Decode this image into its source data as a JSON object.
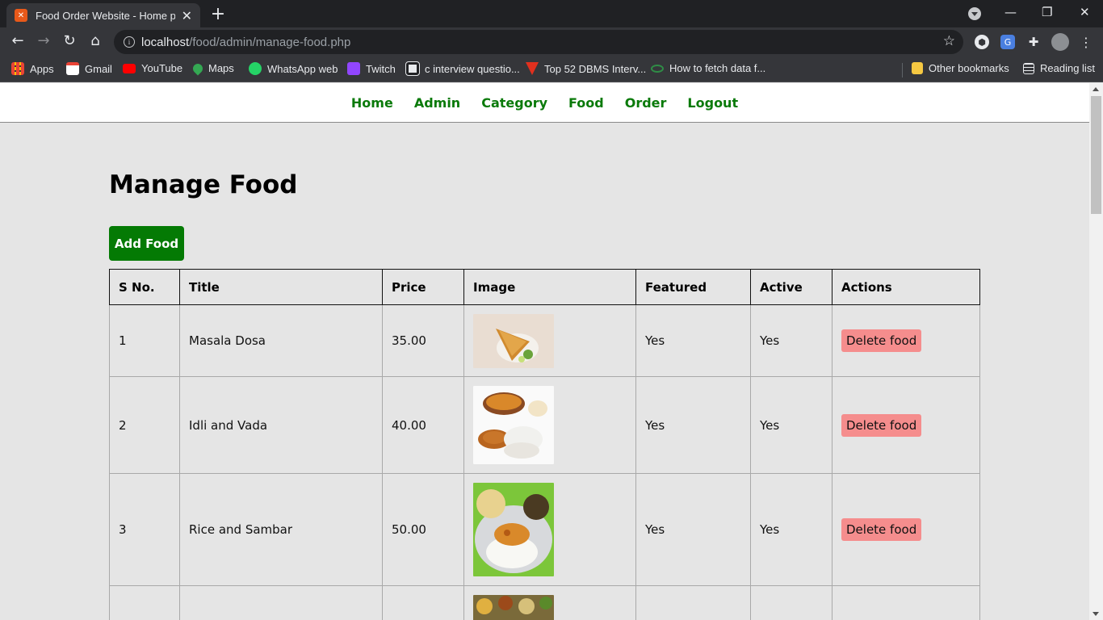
{
  "browser": {
    "tab_title": "Food Order Website - Home page",
    "favicon_letter": "✕",
    "new_tab": "+",
    "url_host": "localhost",
    "url_path": "/food/admin/manage-food.php",
    "bookmarks": [
      {
        "label": "Apps",
        "color": "#4285f4"
      },
      {
        "label": "Gmail",
        "color": "#ea4335"
      },
      {
        "label": "YouTube",
        "color": "#ff0000"
      },
      {
        "label": "Maps",
        "color": "#34a853"
      },
      {
        "label": "WhatsApp web",
        "color": "#25d366"
      },
      {
        "label": "Twitch",
        "color": "#9146ff"
      },
      {
        "label": "c interview questio...",
        "color": "#e8eaed"
      },
      {
        "label": "Top 52 DBMS Interv...",
        "color": "#e0301e"
      },
      {
        "label": "How to fetch data f...",
        "color": "#2f8d46"
      }
    ],
    "other_bookmarks": "Other bookmarks",
    "reading_list": "Reading list"
  },
  "site_nav": {
    "home": "Home",
    "admin": "Admin",
    "category": "Category",
    "food": "Food",
    "order": "Order",
    "logout": "Logout"
  },
  "main": {
    "title": "Manage Food",
    "add_button": "Add Food",
    "columns": [
      "S No.",
      "Title",
      "Price",
      "Image",
      "Featured",
      "Active",
      "Actions"
    ],
    "rows": [
      {
        "sno": "1",
        "title": "Masala Dosa",
        "price": "35.00",
        "featured": "Yes",
        "active": "Yes",
        "action": "Delete food",
        "image_icon": "masala-dosa"
      },
      {
        "sno": "2",
        "title": "Idli and Vada",
        "price": "40.00",
        "featured": "Yes",
        "active": "Yes",
        "action": "Delete food",
        "image_icon": "idli-vada"
      },
      {
        "sno": "3",
        "title": "Rice and Sambar",
        "price": "50.00",
        "featured": "Yes",
        "active": "Yes",
        "action": "Delete food",
        "image_icon": "rice-sambar"
      },
      {
        "sno": "",
        "title": "",
        "price": "",
        "featured": "",
        "active": "",
        "action": "",
        "image_icon": "thali"
      }
    ]
  },
  "colors": {
    "nav_link": "#0a7a0a",
    "add_button_bg": "#047a04",
    "delete_button_bg": "#f58d8d",
    "page_bg": "#e5e5e5"
  }
}
